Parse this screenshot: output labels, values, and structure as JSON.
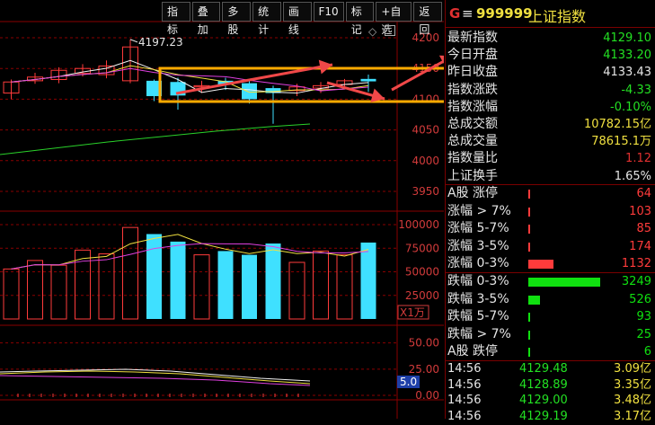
{
  "toolbar": {
    "buttons": [
      "指标",
      "叠加",
      "多股",
      "统计",
      "画线",
      "F10",
      "标记",
      "+自选",
      "返回"
    ]
  },
  "header": {
    "badge": "G",
    "menu_glyph": "≡",
    "code": "999999",
    "name": "上证指数"
  },
  "chart": {
    "price_axis": [
      "4200",
      "4150",
      "4100",
      "4050",
      "4000",
      "3950"
    ],
    "high_label": "4197.23",
    "volume_axis": [
      "100000",
      "75000",
      "50000",
      "25000"
    ],
    "volume_unit": "X1万",
    "indicator_axis": [
      "50.00",
      "25.00",
      "0.00"
    ],
    "indicator_value": "5.0",
    "candles": [
      {
        "o": 4110,
        "c": 4128,
        "h": 4132,
        "l": 4100
      },
      {
        "o": 4130,
        "c": 4136,
        "h": 4143,
        "l": 4125
      },
      {
        "o": 4132,
        "c": 4147,
        "h": 4152,
        "l": 4126
      },
      {
        "o": 4142,
        "c": 4150,
        "h": 4157,
        "l": 4137
      },
      {
        "o": 4140,
        "c": 4154,
        "h": 4163,
        "l": 4134
      },
      {
        "o": 4130,
        "c": 4185,
        "h": 4197.23,
        "l": 4126
      },
      {
        "o": 4130,
        "c": 4105,
        "h": 4132,
        "l": 4097
      },
      {
        "o": 4128,
        "c": 4106,
        "h": 4135,
        "l": 4083
      },
      {
        "o": 4120,
        "c": 4122,
        "h": 4130,
        "l": 4110
      },
      {
        "o": 4130,
        "c": 4124,
        "h": 4135,
        "l": 4115
      },
      {
        "o": 4126,
        "c": 4100,
        "h": 4130,
        "l": 4093
      },
      {
        "o": 4118,
        "c": 4110,
        "h": 4122,
        "l": 4060
      },
      {
        "o": 4114,
        "c": 4120,
        "h": 4125,
        "l": 4105
      },
      {
        "o": 4118,
        "c": 4122,
        "h": 4128,
        "l": 4110
      },
      {
        "o": 4124,
        "c": 4130,
        "h": 4133,
        "l": 4118
      },
      {
        "o": 4133,
        "c": 4129,
        "h": 4140,
        "l": 4112
      }
    ],
    "volumes": [
      53000,
      62000,
      57000,
      73000,
      69000,
      97000,
      90000,
      82000,
      68000,
      72000,
      68000,
      80000,
      60000,
      72000,
      68000,
      81000
    ]
  },
  "stats": [
    {
      "label": "最新指数",
      "value": "4129.10",
      "color": "#23e023"
    },
    {
      "label": "今日开盘",
      "value": "4133.20",
      "color": "#23e023"
    },
    {
      "label": "昨日收盘",
      "value": "4133.43",
      "color": "#e6e6e6"
    },
    {
      "label": "指数涨跌",
      "value": "-4.33",
      "color": "#23e023"
    },
    {
      "label": "指数涨幅",
      "value": "-0.10%",
      "color": "#23e023"
    },
    {
      "label": "总成交额",
      "value": "10782.15亿",
      "color": "#f0e040"
    },
    {
      "label": "总成交量",
      "value": "78615.1万",
      "color": "#f0e040"
    },
    {
      "label": "指数量比",
      "value": "1.12",
      "color": "#e03030"
    },
    {
      "label": "上证换手",
      "value": "1.65%",
      "color": "#e6e6e6"
    }
  ],
  "breadth_up": [
    {
      "label": "A股 涨停",
      "value": "64",
      "bar": 0.01
    },
    {
      "label": "涨幅 > 7%",
      "value": "103",
      "bar": 0.02
    },
    {
      "label": "涨幅 5-7%",
      "value": "85",
      "bar": 0.015
    },
    {
      "label": "涨幅 3-5%",
      "value": "174",
      "bar": 0.03
    },
    {
      "label": "涨幅 0-3%",
      "value": "1132",
      "bar": 0.35
    }
  ],
  "breadth_down": [
    {
      "label": "跌幅 0-3%",
      "value": "3249",
      "bar": 1.0
    },
    {
      "label": "跌幅 3-5%",
      "value": "526",
      "bar": 0.16
    },
    {
      "label": "跌幅 5-7%",
      "value": "93",
      "bar": 0.02
    },
    {
      "label": "跌幅 > 7%",
      "value": "25",
      "bar": 0.01
    },
    {
      "label": "A股 跌停",
      "value": "6",
      "bar": 0.005
    }
  ],
  "ticks": [
    {
      "time": "14:56",
      "price": "4129.48",
      "volume": "3.09亿"
    },
    {
      "time": "14:56",
      "price": "4128.89",
      "volume": "3.35亿"
    },
    {
      "time": "14:56",
      "price": "4129.00",
      "volume": "3.48亿"
    },
    {
      "time": "14:56",
      "price": "4129.19",
      "volume": "3.17亿"
    }
  ]
}
